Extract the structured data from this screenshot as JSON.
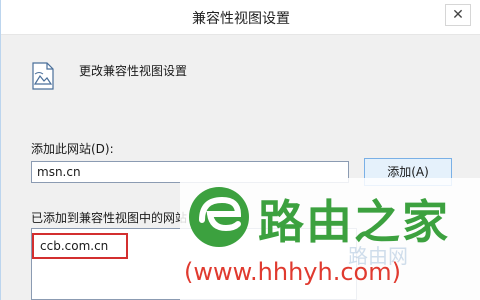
{
  "window": {
    "title": "兼容性视图设置",
    "close_glyph": "✕"
  },
  "header": {
    "icon": "compatibility-view-icon",
    "text": "更改兼容性视图设置"
  },
  "add_site": {
    "label": "添加此网站(D):",
    "value": "msn.cn",
    "button_label": "添加(A)"
  },
  "site_list": {
    "label": "已添加到兼容性视图中的网站",
    "items": [
      "ccb.com.cn"
    ],
    "highlight_color": "#d32f2f"
  },
  "watermark": {
    "name": "路由之家",
    "url": "(www.hhhyh.com)",
    "faint_text": "路由网",
    "colors": {
      "name": "#3ca13f",
      "url": "#e03a2f"
    }
  }
}
